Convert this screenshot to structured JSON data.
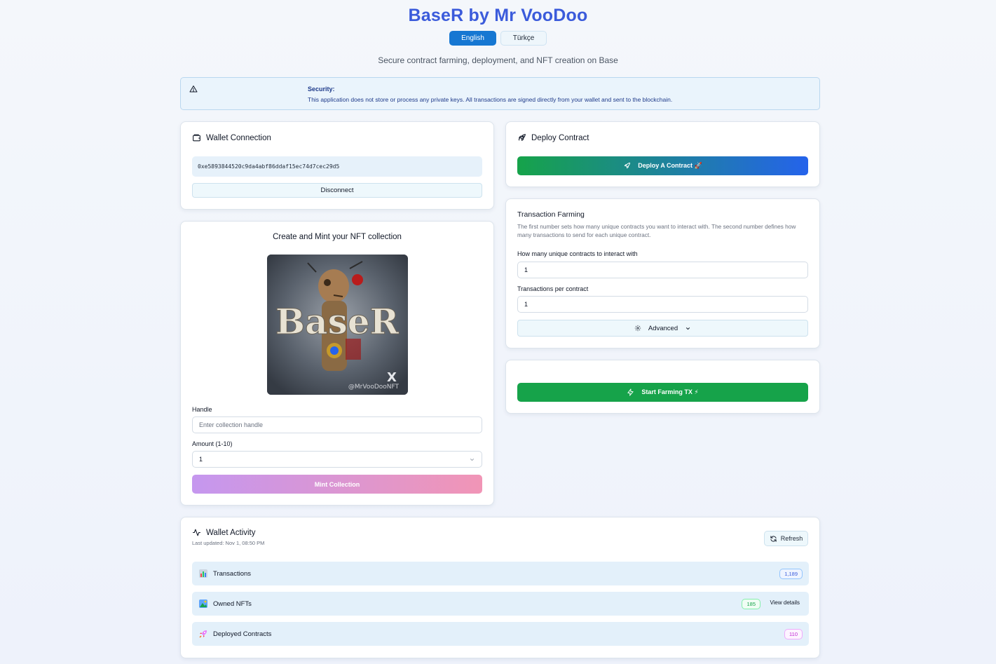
{
  "app": {
    "title": "BaseR by Mr VooDoo",
    "subtitle": "Secure contract farming, deployment, and NFT creation on Base",
    "languages": [
      {
        "label": "English",
        "active": true
      },
      {
        "label": "Türkçe",
        "active": false
      }
    ]
  },
  "security": {
    "title": "Security:",
    "text": "This application does not store or process any private keys. All transactions are signed directly from your wallet and sent to the blockchain."
  },
  "wallet": {
    "title": "Wallet Connection",
    "address": "0xe5893844520c9da4abf86ddaf15ec74d7cec29d5",
    "disconnect_label": "Disconnect"
  },
  "nft": {
    "title": "Create and Mint your NFT collection",
    "image_text": "BaseR",
    "image_handle": "@MrVooDooNFT",
    "handle_label": "Handle",
    "handle_placeholder": "Enter collection handle",
    "amount_label": "Amount (1-10)",
    "amount_value": "1",
    "mint_label": "Mint Collection"
  },
  "deploy": {
    "title": "Deploy Contract",
    "button_label": "Deploy A Contract 🚀"
  },
  "farming": {
    "title": "Transaction Farming",
    "description": "The first number sets how many unique contracts you want to interact with. The second number defines how many transactions to send for each unique contract.",
    "contracts_label": "How many unique contracts to interact with",
    "contracts_value": "1",
    "tx_label": "Transactions per contract",
    "tx_value": "1",
    "advanced_label": "Advanced"
  },
  "start": {
    "button_label": "Start Farming TX ⚡"
  },
  "activity": {
    "title": "Wallet Activity",
    "updated": "Last updated: Nov 1, 08:50 PM",
    "refresh_label": "Refresh",
    "rows": [
      {
        "label": "Transactions",
        "count": "1,189",
        "color": "#3b5bdb",
        "emoji": "📊"
      },
      {
        "label": "Owned NFTs",
        "count": "185",
        "color": "#16a34a",
        "action": "View details",
        "emoji": "🖼"
      },
      {
        "label": "Deployed Contracts",
        "count": "110",
        "color": "#c026d3",
        "emoji": "🚀"
      }
    ]
  }
}
